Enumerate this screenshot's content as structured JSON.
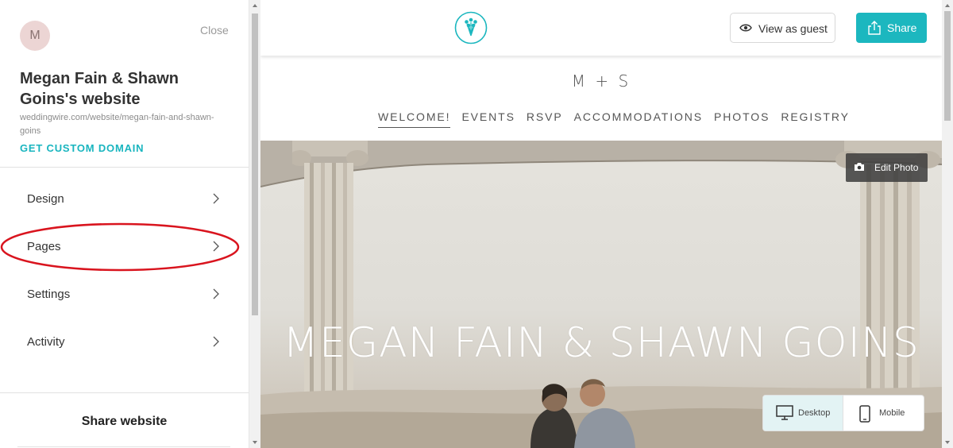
{
  "sidebar": {
    "avatar_initial": "M",
    "close_label": "Close",
    "site_title": "Megan Fain & Shawn Goins's website",
    "site_url": "weddingwire.com/website/megan-fain-and-shawn-goins",
    "custom_domain_label": "GET CUSTOM DOMAIN",
    "menu": [
      {
        "label": "Design"
      },
      {
        "label": "Pages"
      },
      {
        "label": "Settings"
      },
      {
        "label": "Activity"
      }
    ],
    "share_website_label": "Share website",
    "highlighted_item": "Pages"
  },
  "topbar": {
    "logo_icon": "bouquet-icon",
    "view_as_guest_label": "View as guest",
    "share_label": "Share"
  },
  "site": {
    "monogram": "M + S",
    "nav": [
      "WELCOME!",
      "EVENTS",
      "RSVP",
      "ACCOMMODATIONS",
      "PHOTOS",
      "REGISTRY"
    ],
    "active_nav": "WELCOME!",
    "hero_title": "MEGAN FAIN & SHAWN GOINS",
    "edit_photo_label": "Edit Photo"
  },
  "device_toggle": {
    "desktop_label": "Desktop",
    "mobile_label": "Mobile",
    "selected": "Desktop"
  },
  "colors": {
    "accent": "#1cb7bf",
    "highlight_oval": "#d9141e",
    "sidebar_link": "#19b5bf"
  }
}
